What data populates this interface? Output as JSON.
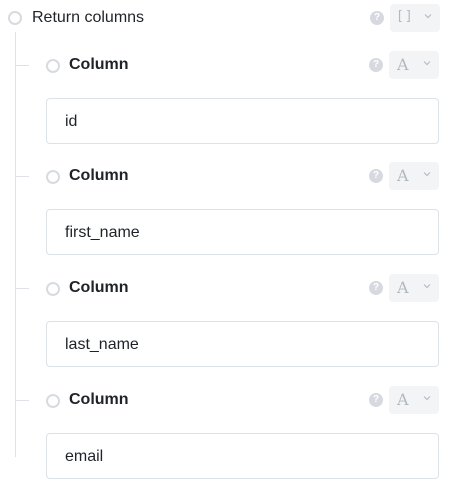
{
  "root": {
    "label": "Return columns",
    "help_icon": "?",
    "type_icon": "[]"
  },
  "columns": [
    {
      "label": "Column",
      "value": "id",
      "help_icon": "?",
      "type_icon": "A"
    },
    {
      "label": "Column",
      "value": "first_name",
      "help_icon": "?",
      "type_icon": "A"
    },
    {
      "label": "Column",
      "value": "last_name",
      "help_icon": "?",
      "type_icon": "A"
    },
    {
      "label": "Column",
      "value": "email",
      "help_icon": "?",
      "type_icon": "A"
    }
  ]
}
